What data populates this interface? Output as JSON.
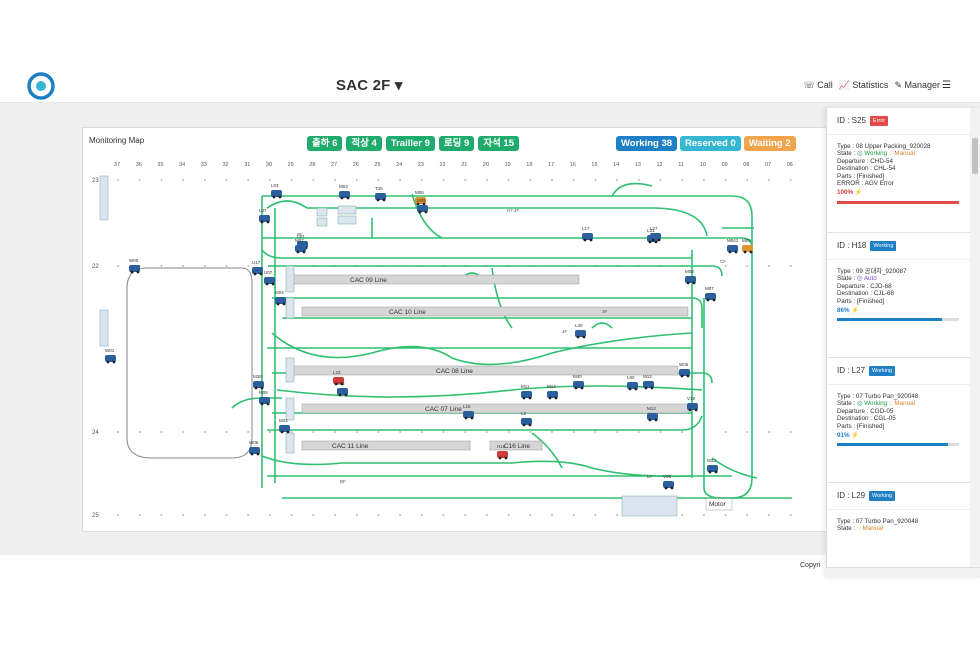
{
  "header": {
    "title": "SAC 2F ▾",
    "nav": [
      "☏ Call",
      "📈 Statistics",
      "✎ Manager"
    ],
    "menu_icon": "☰"
  },
  "map": {
    "panel_title": "Monitoring Map",
    "counts": [
      {
        "label": "출하 6"
      },
      {
        "label": "적상 4"
      },
      {
        "label": "Trailler 9"
      },
      {
        "label": "로딩 9"
      },
      {
        "label": "자석 15"
      }
    ],
    "status": [
      {
        "label": "Working 38",
        "color": "#1f7fc4"
      },
      {
        "label": "Reserved 0",
        "color": "#35b7d3"
      },
      {
        "label": "Waiting 2",
        "color": "#f0a44b"
      }
    ],
    "column_labels": [
      "37",
      "36",
      "35",
      "34",
      "33",
      "32",
      "31",
      "30",
      "29",
      "28",
      "27",
      "26",
      "25",
      "24",
      "23",
      "22",
      "21",
      "20",
      "19",
      "18",
      "17",
      "16",
      "15",
      "14",
      "13",
      "12",
      "11",
      "10",
      "09",
      "08",
      "07",
      "06"
    ],
    "row_labels": [
      "23",
      "22",
      "24",
      "25"
    ],
    "lines": [
      {
        "label": "CAC 09 Line"
      },
      {
        "label": "CAC 10 Line"
      },
      {
        "label": "CAC 08 Line"
      },
      {
        "label": "CAC 07 Line"
      },
      {
        "label": "CAC 11 Line"
      },
      {
        "label": "C16 Line"
      }
    ],
    "vehicles": [
      "L03",
      "M03",
      "T25",
      "L07",
      "M06",
      "L97",
      "M07",
      "L17",
      "M05",
      "L31",
      "L27",
      "M041",
      "M09",
      "W05",
      "U17",
      "U07",
      "M08",
      "M07",
      "W01",
      "L30",
      "M04",
      "M38",
      "L23",
      "L36",
      "M11",
      "M14",
      "M40",
      "L80",
      "M13",
      "W05",
      "M08",
      "L15",
      "L2",
      "M13",
      "W06",
      "H16",
      "V05",
      "M33",
      "V19",
      "M34"
    ],
    "small_labels": [
      "Motor",
      "H7.4F",
      "9F",
      "3F",
      "BF",
      "4F",
      "bF",
      "CF"
    ]
  },
  "sidepanel": {
    "cards": [
      {
        "id_label": "ID : S25",
        "tag": "Error",
        "tag_color": "#e24a4a",
        "type": "Type : 08 Upper Packing_920028",
        "state_label": "State : ",
        "state_a": "◎ Working",
        "state_b": "◌ Manual",
        "departure": "Departure : CHD-54",
        "destination": "Destination : CHL-54",
        "parts": "Parts : [Finished]",
        "error": "ERROR : AGV Error",
        "percent": "100% ⚡",
        "progress": 1.0,
        "bar_color": "#e24a4a",
        "pct_color": "#d23b3b"
      },
      {
        "id_label": "ID : H18",
        "tag": "Working",
        "tag_color": "#1f7fc4",
        "type": "Type : 09 공대차_920087",
        "state_label": "State : ",
        "state_a": "◎ Auto",
        "state_b": "",
        "departure": "Departure : CJD-68",
        "destination": "Destination : CJL-68",
        "parts": "Parts : [Finished]",
        "error": "",
        "percent": "86% ⚡",
        "progress": 0.86,
        "bar_color": "#1f7fc4",
        "pct_color": "#1f7fc4"
      },
      {
        "id_label": "ID : L27",
        "tag": "Working",
        "tag_color": "#1f7fc4",
        "type": "Type : 07 Turbo Pan_920048",
        "state_label": "State : ",
        "state_a": "◎ Working",
        "state_b": "◌ Manual",
        "departure": "Departure : CGD-05",
        "destination": "Destination : CGL-05",
        "parts": "Parts : [Finished]",
        "error": "",
        "percent": "91% ⚡",
        "progress": 0.91,
        "bar_color": "#1f7fc4",
        "pct_color": "#1f7fc4"
      },
      {
        "id_label": "ID : L29",
        "tag": "Working",
        "tag_color": "#1f7fc4",
        "type": "Type : 07 Turbo Pan_920048",
        "state_label": "State : ",
        "state_a": "",
        "state_b": "◌ Manual",
        "departure": "",
        "destination": "",
        "parts": "",
        "error": "",
        "percent": "",
        "progress": 0,
        "bar_color": "#1f7fc4",
        "pct_color": "#1f7fc4"
      }
    ]
  },
  "footer": {
    "copyright": "Copyri"
  },
  "colors": {
    "track": "#2fbf71",
    "vehicle": "#2b5f9e",
    "vehicle_error": "#d23b3b",
    "vehicle_wait": "#e0962e"
  }
}
